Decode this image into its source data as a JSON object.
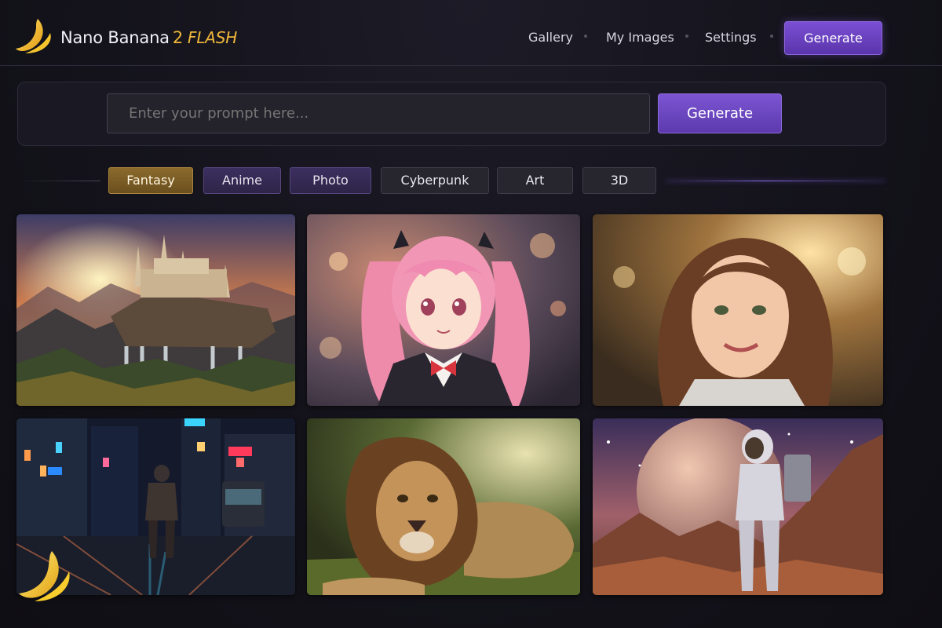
{
  "app": {
    "name": "Nano Banana",
    "version": "2",
    "edition": "FLASH",
    "logo_icon": "banana-icon",
    "accent_color": "#6a44c4",
    "brand_gold": "#f0b73a"
  },
  "nav": {
    "items": [
      "Gallery",
      "My Images",
      "Settings"
    ],
    "generate_label": "Generate"
  },
  "prompt": {
    "placeholder": "Enter your prompt here...",
    "value": "",
    "generate_label": "Generate"
  },
  "filters": {
    "chips": [
      "Fantasy",
      "Anime",
      "Photo",
      "Cyberpunk",
      "Art",
      "3D"
    ],
    "active": "Fantasy"
  },
  "gallery": {
    "images": [
      {
        "subject": "fantasy castle on a floating cliff with waterfalls at sunset"
      },
      {
        "subject": "anime girl with pink twin tails in a school uniform"
      },
      {
        "subject": "portrait of a smiling woman with long brown hair"
      },
      {
        "subject": "person walking down a neon-lit cyberpunk street at night"
      },
      {
        "subject": "lion lying in tall grass"
      },
      {
        "subject": "astronaut on an alien planet facing a giant moon"
      }
    ]
  }
}
